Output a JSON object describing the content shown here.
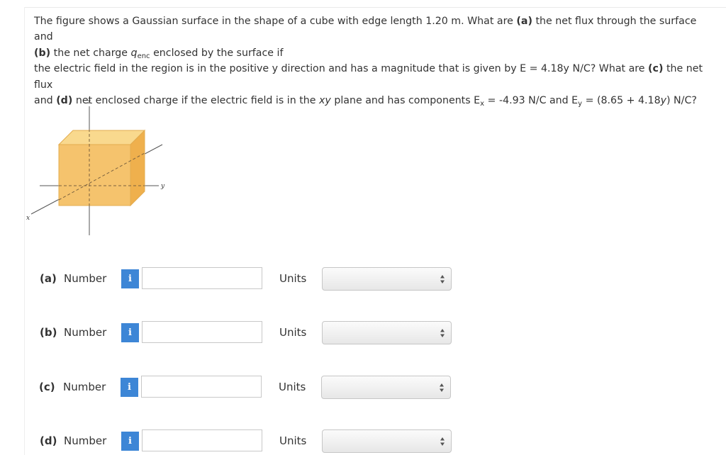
{
  "question": {
    "line1_pre": "The figure shows a Gaussian surface in the shape of a cube with edge length 1.20 m. What are ",
    "a_tag": "(a)",
    "line1_post": " the net flux through the surface and",
    "b_tag": "(b)",
    "line2_pre": " the net charge ",
    "q_symbol": "q",
    "q_sub": "enc",
    "line2_post": " enclosed by the surface if",
    "line3": "the electric field in the region is in the positive y direction and has a magnitude that is given by E = 4.18y N/C? What are ",
    "c_tag": "(c)",
    "line3_post": " the net flux",
    "line4_pre": "and ",
    "d_tag": "(d)",
    "line4_mid": " net enclosed charge if the electric field is in the ",
    "xy": "xy",
    "line4_mid2": " plane and has components E",
    "ex_sub": "x",
    "ex_val": " = -4.93 N/C and E",
    "ey_sub": "y",
    "ey_val": " = (8.65 + 4.18",
    "ey_y": "y",
    "ey_end": ") N/C?"
  },
  "figure": {
    "axis_z": "z",
    "axis_y": "y",
    "axis_x": "x",
    "cube_color": "#f5c36d"
  },
  "parts": [
    {
      "label": "(a)",
      "number_label": "Number",
      "info": "i",
      "value": "",
      "units_label": "Units",
      "units_value": ""
    },
    {
      "label": "(b)",
      "number_label": "Number",
      "info": "i",
      "value": "",
      "units_label": "Units",
      "units_value": ""
    },
    {
      "label": "(c)",
      "number_label": "Number",
      "info": "i",
      "value": "",
      "units_label": "Units",
      "units_value": ""
    },
    {
      "label": "(d)",
      "number_label": "Number",
      "info": "i",
      "value": "",
      "units_label": "Units",
      "units_value": ""
    }
  ],
  "colors": {
    "info_button": "#3d86d6"
  }
}
